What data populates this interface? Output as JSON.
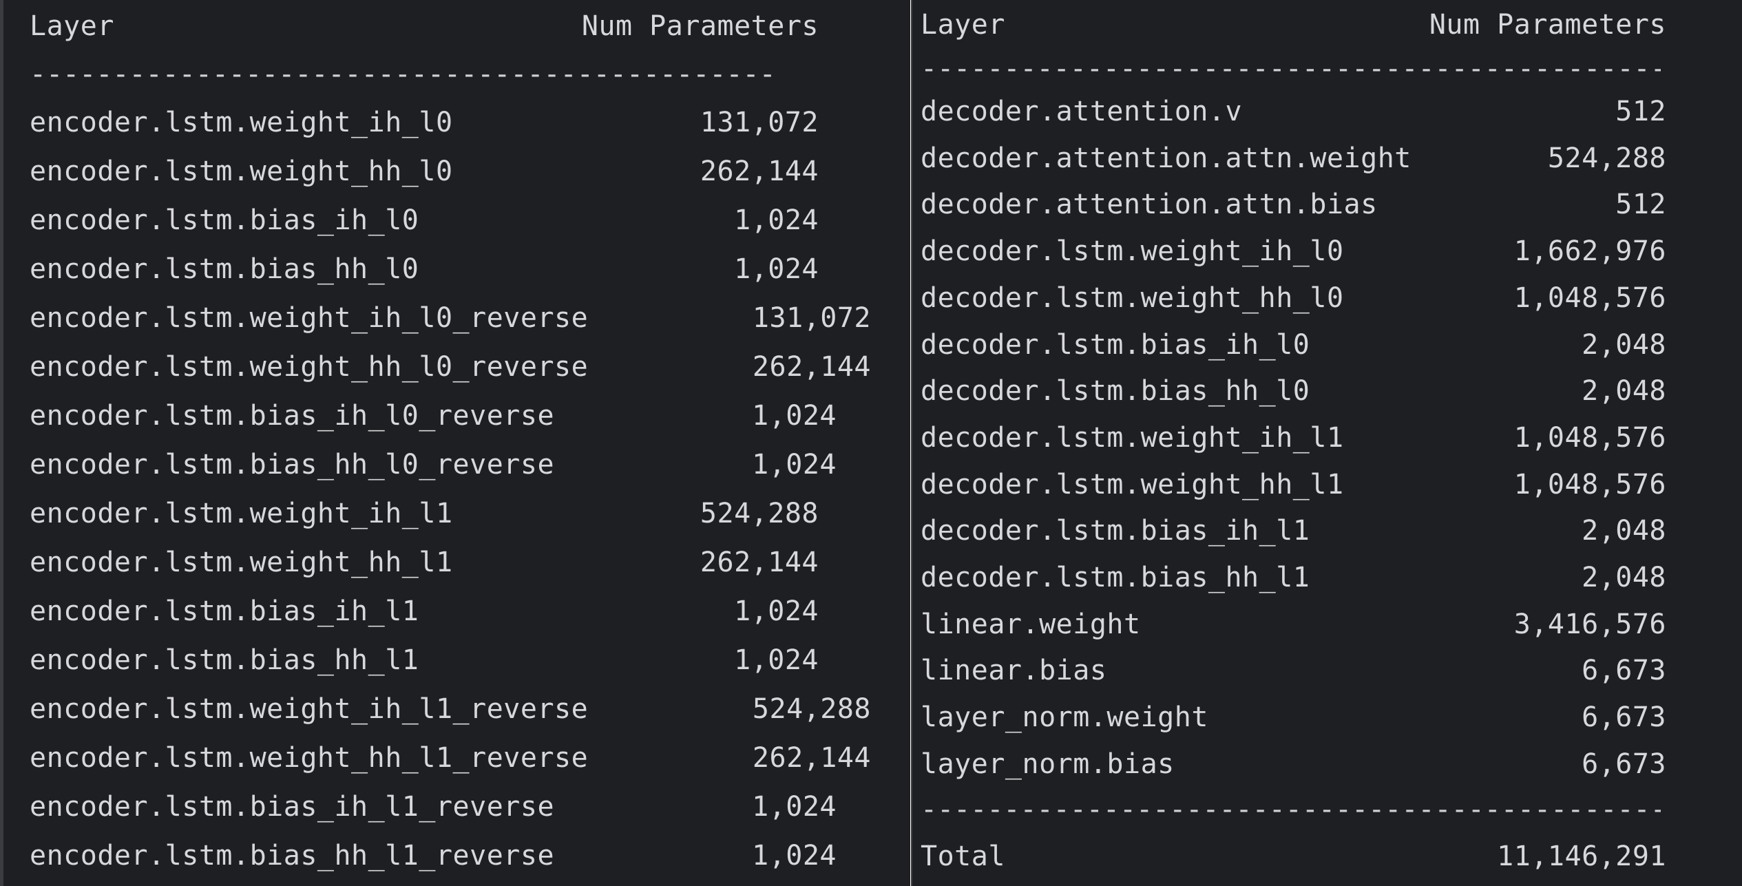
{
  "left": {
    "header_layer": "Layer",
    "header_params": "Num Parameters",
    "separator": "---------------------------------------------",
    "rows": [
      {
        "name": "encoder.lstm.weight_ih_l0",
        "value": "131,072"
      },
      {
        "name": "encoder.lstm.weight_hh_l0",
        "value": "262,144"
      },
      {
        "name": "encoder.lstm.bias_ih_l0",
        "value": "1,024"
      },
      {
        "name": "encoder.lstm.bias_hh_l0",
        "value": "1,024"
      },
      {
        "name": "encoder.lstm.weight_ih_l0_reverse",
        "value": "131,072"
      },
      {
        "name": "encoder.lstm.weight_hh_l0_reverse",
        "value": "262,144"
      },
      {
        "name": "encoder.lstm.bias_ih_l0_reverse",
        "value": "1,024"
      },
      {
        "name": "encoder.lstm.bias_hh_l0_reverse",
        "value": "1,024"
      },
      {
        "name": "encoder.lstm.weight_ih_l1",
        "value": "524,288"
      },
      {
        "name": "encoder.lstm.weight_hh_l1",
        "value": "262,144"
      },
      {
        "name": "encoder.lstm.bias_ih_l1",
        "value": "1,024"
      },
      {
        "name": "encoder.lstm.bias_hh_l1",
        "value": "1,024"
      },
      {
        "name": "encoder.lstm.weight_ih_l1_reverse",
        "value": "524,288"
      },
      {
        "name": "encoder.lstm.weight_hh_l1_reverse",
        "value": "262,144"
      },
      {
        "name": "encoder.lstm.bias_ih_l1_reverse",
        "value": "1,024"
      },
      {
        "name": "encoder.lstm.bias_hh_l1_reverse",
        "value": "1,024"
      }
    ]
  },
  "right": {
    "header_layer": "Layer",
    "header_params": "Num Parameters",
    "separator": "---------------------------------------------",
    "rows": [
      {
        "name": "decoder.attention.v",
        "value": "512"
      },
      {
        "name": "decoder.attention.attn.weight",
        "value": "524,288"
      },
      {
        "name": "decoder.attention.attn.bias",
        "value": "512"
      },
      {
        "name": "decoder.lstm.weight_ih_l0",
        "value": "1,662,976"
      },
      {
        "name": "decoder.lstm.weight_hh_l0",
        "value": "1,048,576"
      },
      {
        "name": "decoder.lstm.bias_ih_l0",
        "value": "2,048"
      },
      {
        "name": "decoder.lstm.bias_hh_l0",
        "value": "2,048"
      },
      {
        "name": "decoder.lstm.weight_ih_l1",
        "value": "1,048,576"
      },
      {
        "name": "decoder.lstm.weight_hh_l1",
        "value": "1,048,576"
      },
      {
        "name": "decoder.lstm.bias_ih_l1",
        "value": "2,048"
      },
      {
        "name": "decoder.lstm.bias_hh_l1",
        "value": "2,048"
      },
      {
        "name": "linear.weight",
        "value": "3,416,576"
      },
      {
        "name": "linear.bias",
        "value": "6,673"
      },
      {
        "name": "layer_norm.weight",
        "value": "6,673"
      },
      {
        "name": "layer_norm.bias",
        "value": "6,673"
      }
    ],
    "bottom_separator": "---------------------------------------------",
    "total_label": "Total",
    "total_value": "11,146,291"
  }
}
